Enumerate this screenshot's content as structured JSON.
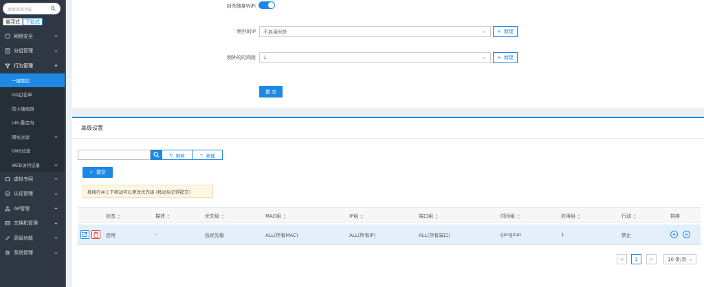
{
  "sidebar": {
    "search_placeholder": "搜索菜单功能",
    "mode_float": "悬浮式",
    "mode_dropdown": "下拉式",
    "items": [
      {
        "label": "网络安全",
        "icon": "shield-icon"
      },
      {
        "label": "分组管理",
        "icon": "list-icon"
      },
      {
        "label": "行为管理",
        "icon": "filter-icon"
      },
      {
        "label": "虚拟专网",
        "icon": "vpn-icon"
      },
      {
        "label": "认证管理",
        "icon": "auth-icon"
      },
      {
        "label": "AP管理",
        "icon": "ap-icon"
      },
      {
        "label": "交换机管理",
        "icon": "switch-icon"
      },
      {
        "label": "高级功能",
        "icon": "advanced-icon"
      },
      {
        "label": "系统管理",
        "icon": "gear-icon"
      }
    ],
    "subitems": [
      {
        "label": "一键管控"
      },
      {
        "label": "QQ白名单"
      },
      {
        "label": "防火墙规则"
      },
      {
        "label": "URL重定向"
      },
      {
        "label": "网址过滤"
      },
      {
        "label": "DNS过滤"
      },
      {
        "label": "WEB访问记录"
      }
    ]
  },
  "form": {
    "wifi_label": "封杀随身WiFi",
    "ip_label": "例外的IP",
    "ip_value": "不启用例外",
    "time_label": "例外的时间段",
    "time_value": "1",
    "new_label": "新建",
    "submit_label": "提 交"
  },
  "advanced": {
    "title": "高级设置",
    "refresh_label": "刷新",
    "new_label": "新建",
    "submit_label": "提交",
    "notice": "拖拽行并上下移动可以更改优先级 (移动后记得提交)"
  },
  "table": {
    "headers": [
      "状态",
      "描述",
      "优先级",
      "MAC组",
      "IP组",
      "端口组",
      "时间组",
      "应用组",
      "行动",
      "排序"
    ],
    "row": {
      "status": "启用",
      "desc": "-",
      "priority": "低优先级",
      "mac": "ALL(所有MAC)",
      "ip": "ALL(所有IP)",
      "port": "ALL(所有端口)",
      "time": "gongzuo",
      "app": "1",
      "action": "禁止"
    }
  },
  "pagination": {
    "prev": "<",
    "current": "1",
    "next": ">",
    "page_size": "10 条/页"
  },
  "colors": {
    "accent": "#1e88e5",
    "sidebar_bg": "#2f3842"
  }
}
